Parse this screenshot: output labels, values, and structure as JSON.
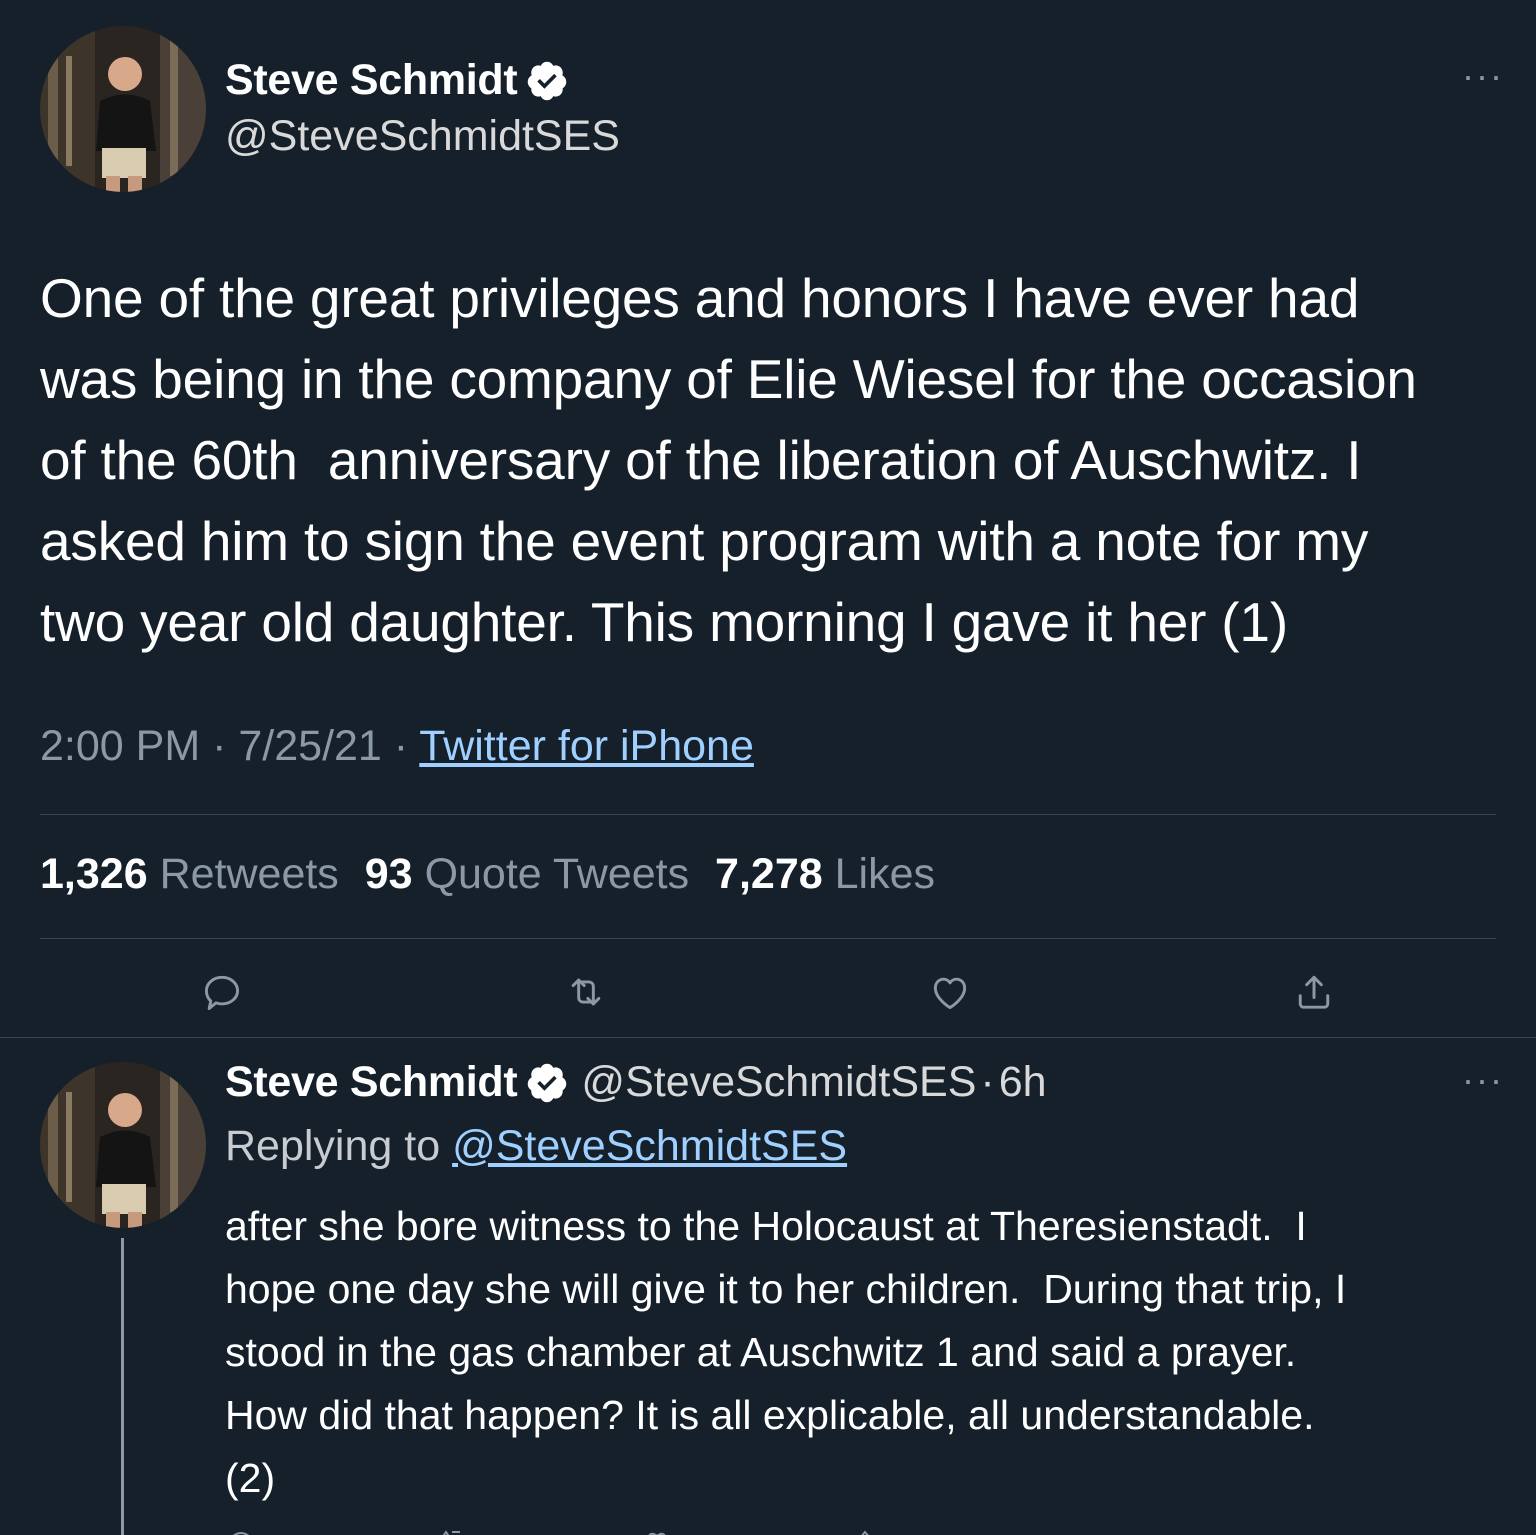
{
  "main_tweet": {
    "display_name": "Steve Schmidt",
    "handle": "@SteveSchmidtSES",
    "more_label": "···",
    "text_lines": [
      "One of the great privileges and honors I have ever had",
      "was being in the company of Elie Wiesel for the occasion",
      "of the 60th  anniversary of the liberation of Auschwitz. I",
      "asked him to sign the event program with a note for my",
      "two year old daughter. This morning I gave it her (1)"
    ],
    "time": "2:00 PM",
    "separator": "·",
    "date": "7/25/21",
    "source": "Twitter for iPhone",
    "stats": {
      "retweets_count": "1,326",
      "retweets_label": "Retweets",
      "quotes_count": "93",
      "quotes_label": "Quote Tweets",
      "likes_count": "7,278",
      "likes_label": "Likes"
    },
    "actions": [
      "reply-icon",
      "retweet-icon",
      "like-icon",
      "share-icon"
    ]
  },
  "reply_tweet": {
    "display_name": "Steve Schmidt",
    "handle": "@SteveSchmidtSES",
    "separator": "·",
    "time_ago": "6h",
    "more_label": "···",
    "replying_prefix": "Replying to",
    "replying_handle": "@SteveSchmidtSES",
    "text_lines": [
      "after she bore witness to the Holocaust at Theresienstadt.  I",
      "hope one day she will give it to her children.  During that trip, I",
      "stood in the gas chamber at Auschwitz 1 and said a prayer.",
      "How did that happen? It is all explicable, all understandable.",
      "(2)"
    ]
  },
  "colors": {
    "background": "#15202b",
    "text": "#ffffff",
    "secondary": "#8b98a5",
    "link": "#9fd0ff",
    "divider": "#38444d"
  }
}
